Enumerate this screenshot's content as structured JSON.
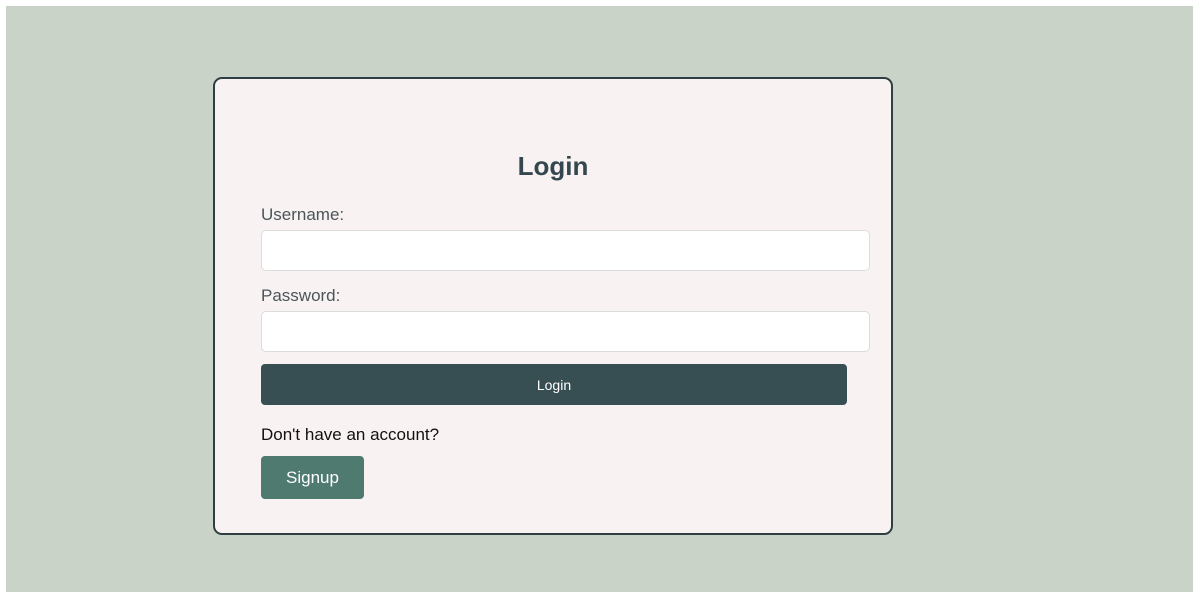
{
  "login_form": {
    "title": "Login",
    "username_label": "Username:",
    "username_value": "",
    "password_label": "Password:",
    "password_value": "",
    "login_button_label": "Login",
    "signup_prompt": "Don't have an account?",
    "signup_button_label": "Signup"
  },
  "colors": {
    "page_background": "#cad3c8",
    "card_background": "#f8f3f2",
    "card_border": "#2f3d44",
    "login_button": "#374f53",
    "signup_button": "#4f7a70",
    "title_text": "#34474f"
  }
}
